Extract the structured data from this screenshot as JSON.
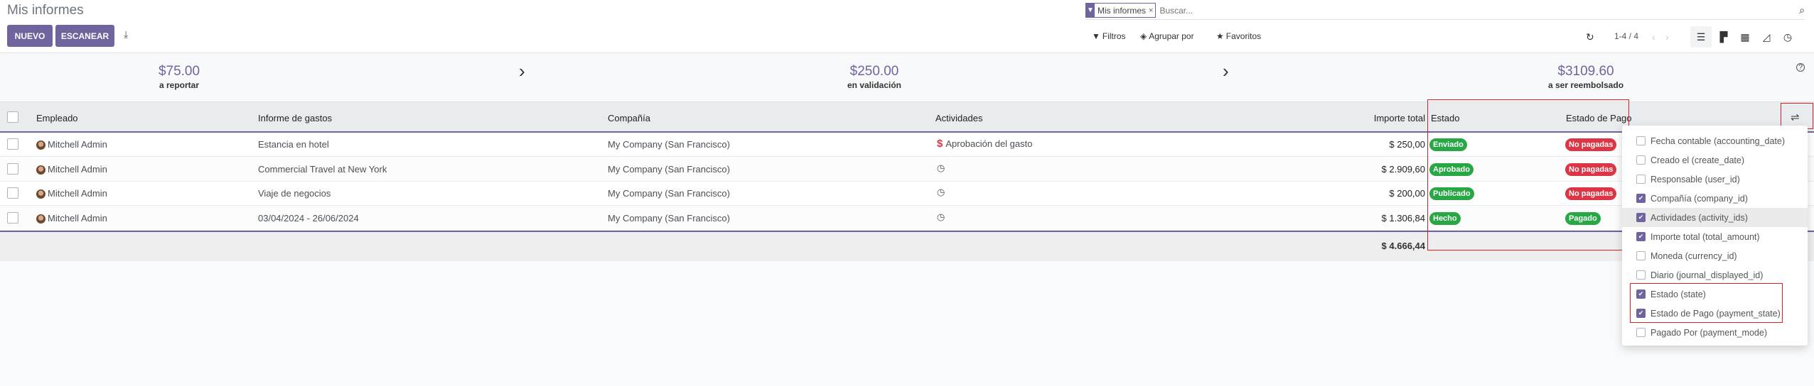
{
  "header": {
    "title": "Mis informes",
    "new_label": "NUEVO",
    "scan_label": "ESCANEAR"
  },
  "search": {
    "facet": "Mis informes",
    "placeholder": "Buscar..."
  },
  "toolbar": {
    "filters": "Filtros",
    "group_by": "Agrupar por",
    "favorites": "Favoritos",
    "pager": "1-4 / 4"
  },
  "summary": [
    {
      "value": "$75.00",
      "label": "a reportar"
    },
    {
      "value": "$250.00",
      "label": "en validación"
    },
    {
      "value": "$3109.60",
      "label": "a ser reembolsado"
    }
  ],
  "table": {
    "columns": [
      "Empleado",
      "Informe de gastos",
      "Compañía",
      "Actividades",
      "Importe total",
      "Estado",
      "Estado de Pago"
    ],
    "rows": [
      {
        "employee": "Mitchell Admin",
        "report": "Estancia en hotel",
        "company": "My Company (San Francisco)",
        "activity": "Aprobación del gasto",
        "activity_icon": "dollar-icon",
        "total": "$ 250,00",
        "state": "Enviado",
        "payment": "No pagadas",
        "payment_color": "#dc3545"
      },
      {
        "employee": "Mitchell Admin",
        "report": "Commercial Travel at New York",
        "company": "My Company (San Francisco)",
        "activity": "",
        "activity_icon": "clock-icon",
        "total": "$ 2.909,60",
        "state": "Aprobado",
        "payment": "No pagadas",
        "payment_color": "#dc3545"
      },
      {
        "employee": "Mitchell Admin",
        "report": "Viaje de negocios",
        "company": "My Company (San Francisco)",
        "activity": "",
        "activity_icon": "clock-icon",
        "total": "$ 200,00",
        "state": "Publicado",
        "payment": "No pagadas",
        "payment_color": "#dc3545"
      },
      {
        "employee": "Mitchell Admin",
        "report": "03/04/2024 - 26/06/2024",
        "company": "My Company (San Francisco)",
        "activity": "",
        "activity_icon": "clock-icon",
        "total": "$ 1.306,84",
        "state": "Hecho",
        "payment": "Pagado",
        "payment_color": "#28a745"
      }
    ],
    "footer_total": "$ 4.666,44"
  },
  "optional_columns": [
    {
      "label": "Fecha contable (accounting_date)",
      "checked": false
    },
    {
      "label": "Creado el (create_date)",
      "checked": false
    },
    {
      "label": "Responsable (user_id)",
      "checked": false
    },
    {
      "label": "Compañía (company_id)",
      "checked": true
    },
    {
      "label": "Actividades (activity_ids)",
      "checked": true
    },
    {
      "label": "Importe total (total_amount)",
      "checked": true
    },
    {
      "label": "Moneda (currency_id)",
      "checked": false
    },
    {
      "label": "Diario (journal_displayed_id)",
      "checked": false
    },
    {
      "label": "Estado (state)",
      "checked": true
    },
    {
      "label": "Estado de Pago (payment_state)",
      "checked": true
    },
    {
      "label": "Pagado Por (payment_mode)",
      "checked": false
    }
  ],
  "colors": {
    "brand": "#71639e",
    "success": "#28a745",
    "danger": "#dc3545",
    "highlight": "#e02020"
  }
}
